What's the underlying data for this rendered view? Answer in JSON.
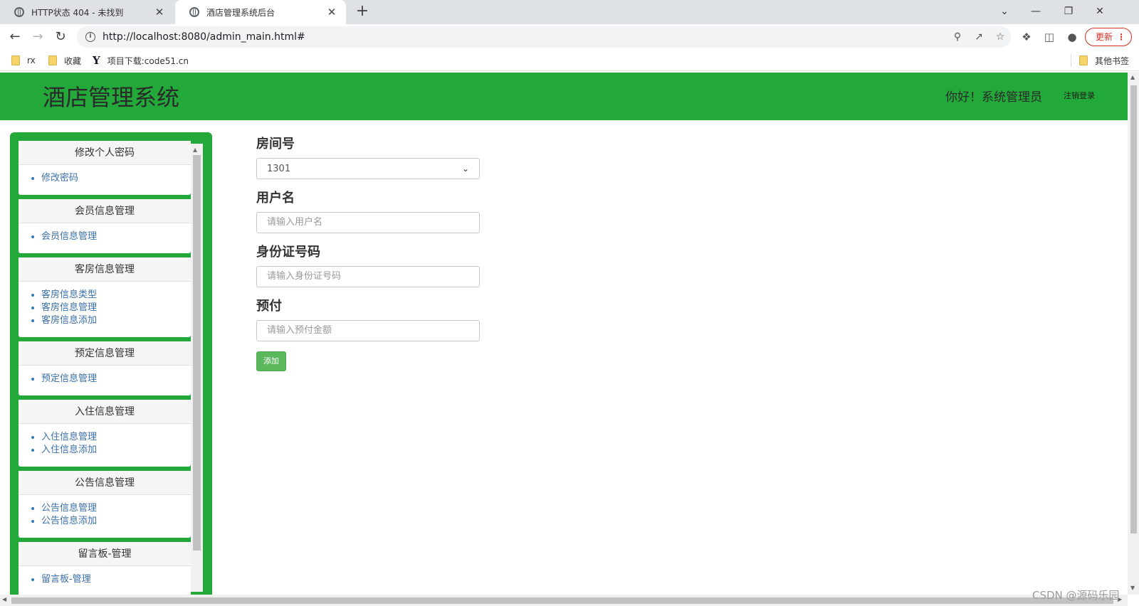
{
  "browser": {
    "tabs": [
      {
        "title": "HTTP状态 404 - 未找到",
        "close": "✕"
      },
      {
        "title": "酒店管理系统后台",
        "close": "✕"
      }
    ],
    "new_tab": "+",
    "window_controls": {
      "dropdown": "⌄",
      "minimize": "—",
      "restore": "❐",
      "close": "✕"
    },
    "url": "http://localhost:8080/admin_main.html#",
    "update_label": "更新",
    "update_menu": "⋮",
    "bookmarks": [
      {
        "label": "rx",
        "icon": "folder-icon"
      },
      {
        "label": "收藏",
        "icon": "folder-icon"
      },
      {
        "label": "项目下载:code51.cn",
        "icon": "y-logo-icon"
      }
    ],
    "bookmarks_other": "其他书签",
    "y_logo": "Y"
  },
  "header": {
    "title": "酒店管理系统",
    "greeting": "你好！系统管理员",
    "logout": "注销登录"
  },
  "sidebar": {
    "panels": [
      {
        "title": "修改个人密码",
        "items": [
          "修改密码"
        ]
      },
      {
        "title": "会员信息管理",
        "items": [
          "会员信息管理"
        ]
      },
      {
        "title": "客房信息管理",
        "items": [
          "客房信息类型",
          "客房信息管理",
          "客房信息添加"
        ]
      },
      {
        "title": "预定信息管理",
        "items": [
          "预定信息管理"
        ]
      },
      {
        "title": "入住信息管理",
        "items": [
          "入住信息管理",
          "入住信息添加"
        ]
      },
      {
        "title": "公告信息管理",
        "items": [
          "公告信息管理",
          "公告信息添加"
        ]
      },
      {
        "title": "留言板-管理",
        "items": [
          "留言板-管理"
        ]
      }
    ]
  },
  "form": {
    "room_label": "房间号",
    "room_value": "1301",
    "username_label": "用户名",
    "username_placeholder": "请输入用户名",
    "idcard_label": "身份证号码",
    "idcard_placeholder": "请输入身份证号码",
    "prepay_label": "预付",
    "prepay_placeholder": "请输入预付金额",
    "submit_label": "添加"
  },
  "watermark": "CSDN @源码乐园",
  "colors": {
    "header_green": "#23a93a",
    "button_green": "#5cb85c",
    "link_blue": "#337ab7"
  }
}
